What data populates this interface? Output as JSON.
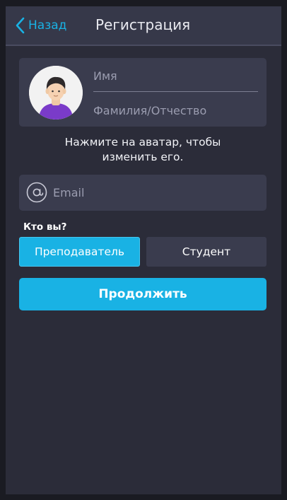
{
  "header": {
    "back_label": "Назад",
    "title": "Регистрация"
  },
  "profile": {
    "first_name_placeholder": "Имя",
    "first_name_value": "",
    "surname_placeholder": "Фамилия/Отчество",
    "surname_value": "",
    "avatar_icon": "default-user-avatar",
    "hint_line1": "Нажмите на аватар, чтобы",
    "hint_line2": "изменить его."
  },
  "email": {
    "icon": "at-sign-icon",
    "placeholder": "Email",
    "value": ""
  },
  "role": {
    "question": "Кто вы?",
    "options": [
      "Преподаватель",
      "Студент"
    ],
    "selected": "Преподаватель"
  },
  "actions": {
    "continue_label": "Продолжить"
  },
  "colors": {
    "accent": "#19b2e4",
    "background": "#2b2c39",
    "header": "#363849",
    "card": "#3a3c4e",
    "avatar_shirt": "#7a3bc9"
  }
}
